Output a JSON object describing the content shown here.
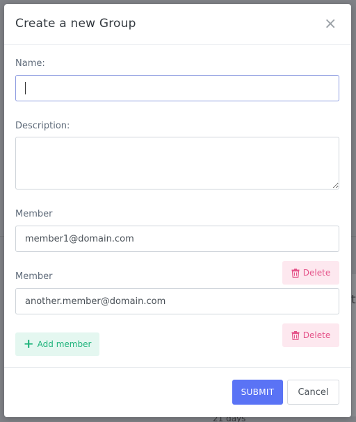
{
  "modal": {
    "title": "Create a new Group",
    "close_glyph": "×"
  },
  "form": {
    "name_label": "Name:",
    "name_value": "",
    "description_label": "Description:",
    "description_value": "",
    "members": [
      {
        "label": "Member",
        "value": "member1@domain.com"
      },
      {
        "label": "Member",
        "value": "another.member@domain.com"
      }
    ],
    "delete_label": "Delete",
    "add_member_label": "Add member"
  },
  "footer": {
    "submit_label": "SUBMIT",
    "cancel_label": "Cancel"
  },
  "background": {
    "fragment_days": "21 days",
    "fragment_t": "t"
  },
  "colors": {
    "primary": "#5a73f5",
    "danger": "#e5548a",
    "success": "#20b47c"
  }
}
